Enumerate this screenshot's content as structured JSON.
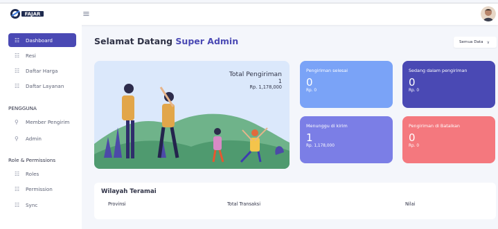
{
  "header": {
    "logo_text": "FAJAR",
    "menu_icon": "hamburger-icon",
    "avatar_icon": "user-avatar"
  },
  "sidebar": {
    "items": [
      {
        "label": "Dashboard",
        "icon": "grid-icon",
        "active": true
      },
      {
        "label": "Resi",
        "icon": "grid-icon"
      },
      {
        "label": "Daftar Harga",
        "icon": "grid-icon"
      },
      {
        "label": "Daftar Layanan",
        "icon": "grid-icon"
      }
    ],
    "section_pengguna": "PENGGUNA",
    "pengguna_items": [
      {
        "label": "Member Pengirim",
        "icon": "user-icon"
      },
      {
        "label": "Admin",
        "icon": "user-icon"
      }
    ],
    "section_roles": "Role & Permissions",
    "role_items": [
      {
        "label": "Roles",
        "icon": "grid-icon"
      },
      {
        "label": "Permission",
        "icon": "grid-icon"
      },
      {
        "label": "Sync",
        "icon": "grid-icon"
      }
    ]
  },
  "main": {
    "welcome_prefix": "Selamat Datang",
    "welcome_name": "Super Admin",
    "filter_label": "Semua Data",
    "hero": {
      "title": "Total Pengiriman",
      "count": "1",
      "amount": "Rp. 1,178,000"
    },
    "stats": [
      {
        "label": "Pengiriman selesai",
        "count": "0",
        "amount": "Rp. 0",
        "color": "#7aa3f7"
      },
      {
        "label": "Sedang dalam pengiriman",
        "count": "0",
        "amount": "Rp. 0",
        "color": "#4a49b4"
      },
      {
        "label": "Menunggu di kirim",
        "count": "1",
        "amount": "Rp. 1,178,000",
        "color": "#7b7ee6"
      },
      {
        "label": "Pengiriman di Batalkan",
        "count": "0",
        "amount": "Rp. 0",
        "color": "#f4787e"
      }
    ],
    "region": {
      "title": "Wilayah Teramai",
      "columns": [
        "Provinsi",
        "Total Transaksi",
        "Nilai"
      ]
    }
  },
  "colors": {
    "accent": "#4a49b4",
    "background": "#f4f6fb",
    "hero_bg": "#dbe8fb"
  }
}
